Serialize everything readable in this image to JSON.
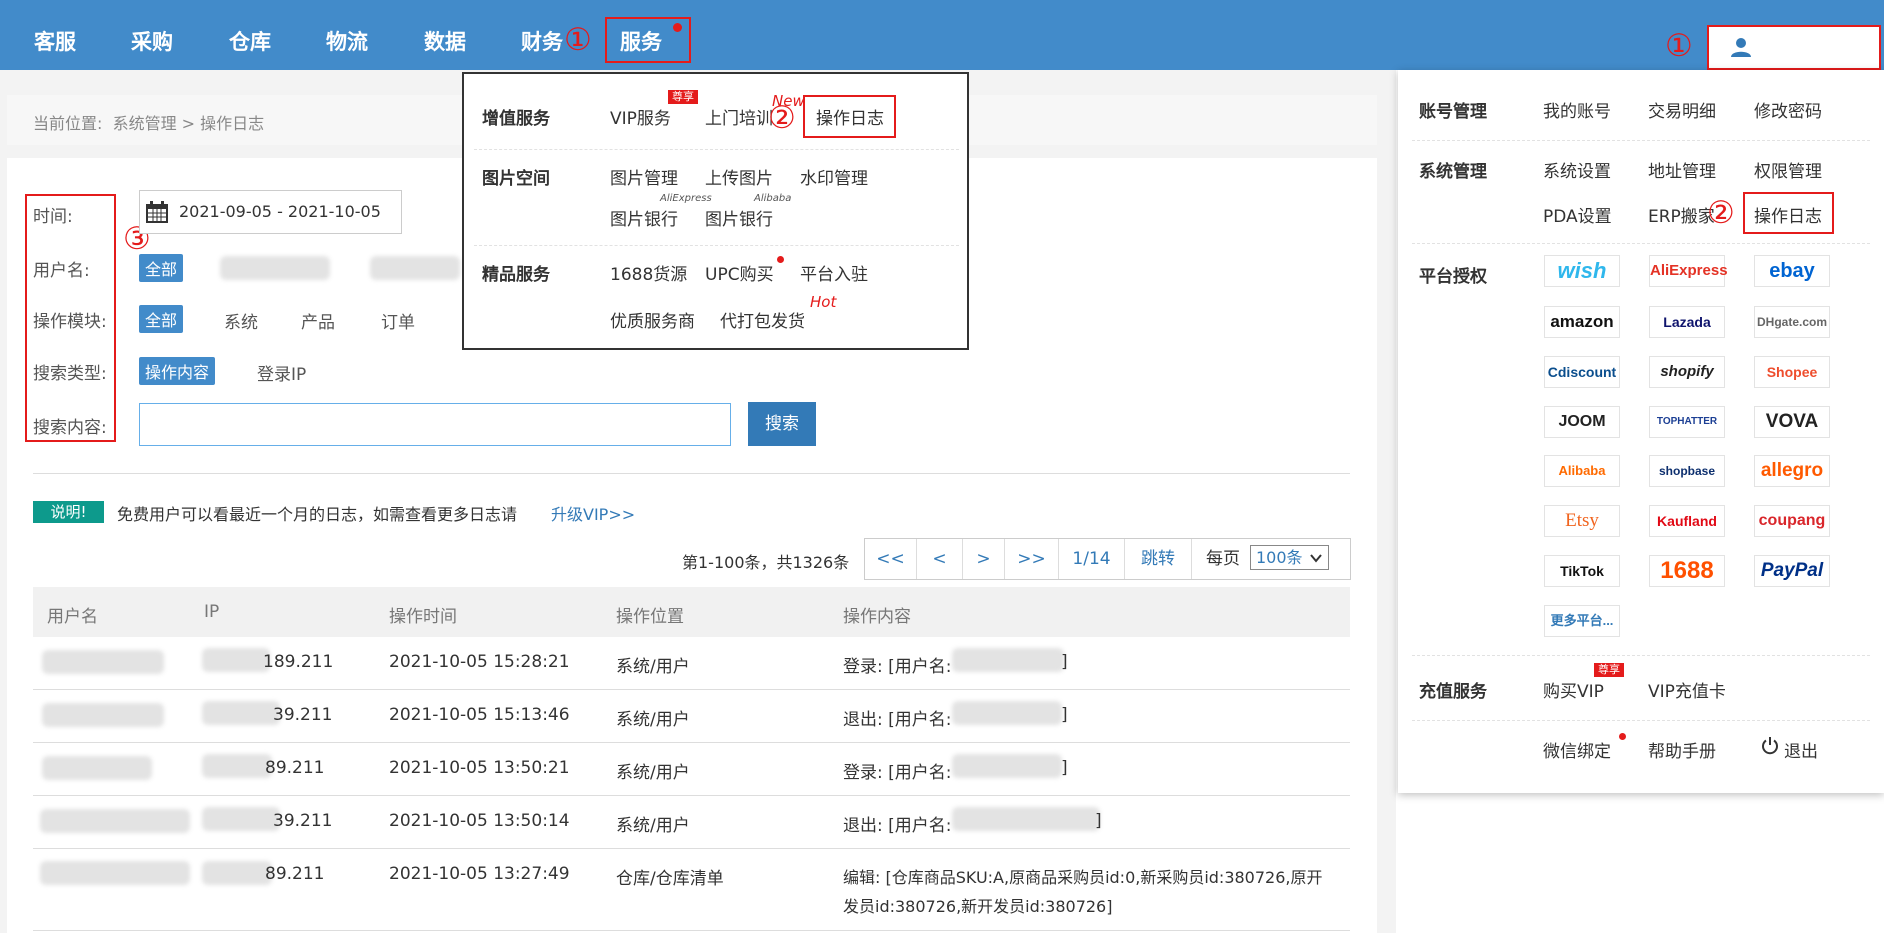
{
  "nav": {
    "items": [
      "客服",
      "采购",
      "仓库",
      "物流",
      "数据",
      "财务",
      "服务"
    ],
    "markers": {
      "one": "①",
      "two": "②",
      "three": "③"
    }
  },
  "breadcrumb": {
    "prefix": "当前位置:",
    "path": "系统管理 > 操作日志"
  },
  "filters": {
    "time_label": "时间:",
    "time_value": "2021-09-05 - 2021-10-05",
    "user_label": "用户名:",
    "user_all": "全部",
    "module_label": "操作模块:",
    "module_options": [
      "全部",
      "系统",
      "产品",
      "订单"
    ],
    "type_label": "搜索类型:",
    "type_options": [
      "操作内容",
      "登录IP"
    ],
    "content_label": "搜索内容:",
    "search_button": "搜索"
  },
  "notice": {
    "tag": "说明!",
    "text": "免费用户可以看最近一个月的日志，如需查看更多日志请",
    "link": "升级VIP>>"
  },
  "pagination": {
    "summary": "第1-100条，共1326条",
    "first": "<<",
    "prev": "<",
    "next": ">",
    "last": ">>",
    "page": "1/14",
    "jump": "跳转",
    "per_page_label": "每页",
    "per_page_value": "100条"
  },
  "table": {
    "headers": [
      "用户名",
      "IP",
      "操作时间",
      "操作位置",
      "操作内容"
    ],
    "rows": [
      {
        "ip": "189.211",
        "time": "2021-10-05 15:28:21",
        "location": "系统/用户",
        "content": "登录: [用户名:",
        "tail": "]"
      },
      {
        "ip": "39.211",
        "time": "2021-10-05 15:13:46",
        "location": "系统/用户",
        "content": "退出: [用户名:",
        "tail": "]"
      },
      {
        "ip": "89.211",
        "time": "2021-10-05 13:50:21",
        "location": "系统/用户",
        "content": "登录: [用户名:",
        "tail": "]"
      },
      {
        "ip": "39.211",
        "time": "2021-10-05 13:50:14",
        "location": "系统/用户",
        "content": "退出: [用户名:",
        "tail": "]"
      },
      {
        "ip": "89.211",
        "time": "2021-10-05 13:27:49",
        "location": "仓库/仓库清单",
        "content": "编辑: [仓库商品SKU:A,原商品采购员id:0,新采购员id:380726,原开",
        "content2": "发员id:380726,新开发员id:380726]"
      }
    ]
  },
  "service_menu": {
    "value_added": {
      "title": "增值服务",
      "items": [
        "VIP服务",
        "上门培训",
        "操作日志"
      ],
      "badge": "尊享",
      "new": "New"
    },
    "images": {
      "title": "图片空间",
      "items": [
        "图片管理",
        "上传图片",
        "水印管理",
        "图片银行",
        "图片银行"
      ],
      "sub": [
        "AliExpress",
        "Alibaba"
      ]
    },
    "premium": {
      "title": "精品服务",
      "items": [
        "1688货源",
        "UPC购买",
        "平台入驻",
        "优质服务商",
        "代打包发货"
      ],
      "hot": "Hot"
    }
  },
  "account_menu": {
    "account": {
      "title": "账号管理",
      "items": [
        "我的账号",
        "交易明细",
        "修改密码"
      ]
    },
    "system": {
      "title": "系统管理",
      "items": [
        "系统设置",
        "地址管理",
        "权限管理",
        "PDA设置",
        "ERP搬家",
        "操作日志"
      ]
    },
    "platforms": {
      "title": "平台授权",
      "items": [
        "wish",
        "AliExpress",
        "ebay",
        "amazon",
        "Lazada",
        "DHgate.com",
        "Cdiscount",
        "shopify",
        "Shopee",
        "JOOM",
        "TOPHATTER",
        "VOVA",
        "Alibaba",
        "shopbase",
        "allegro",
        "Etsy",
        "Kaufland",
        "coupang",
        "TikTok",
        "1688",
        "PayPal"
      ],
      "more": "更多平台..."
    },
    "recharge": {
      "title": "充值服务",
      "items": [
        "购买VIP",
        "VIP充值卡"
      ],
      "badge": "尊享"
    },
    "footer": {
      "items": [
        "微信绑定",
        "帮助手册",
        "退出"
      ]
    }
  },
  "colors": {
    "topbar": "#428bca",
    "accent": "#337ab7",
    "annotation": "#e41b1b",
    "note": "#0d9a8c"
  },
  "icons": [
    "user-icon",
    "calendar-icon",
    "power-icon",
    "chevron-down-icon"
  ]
}
